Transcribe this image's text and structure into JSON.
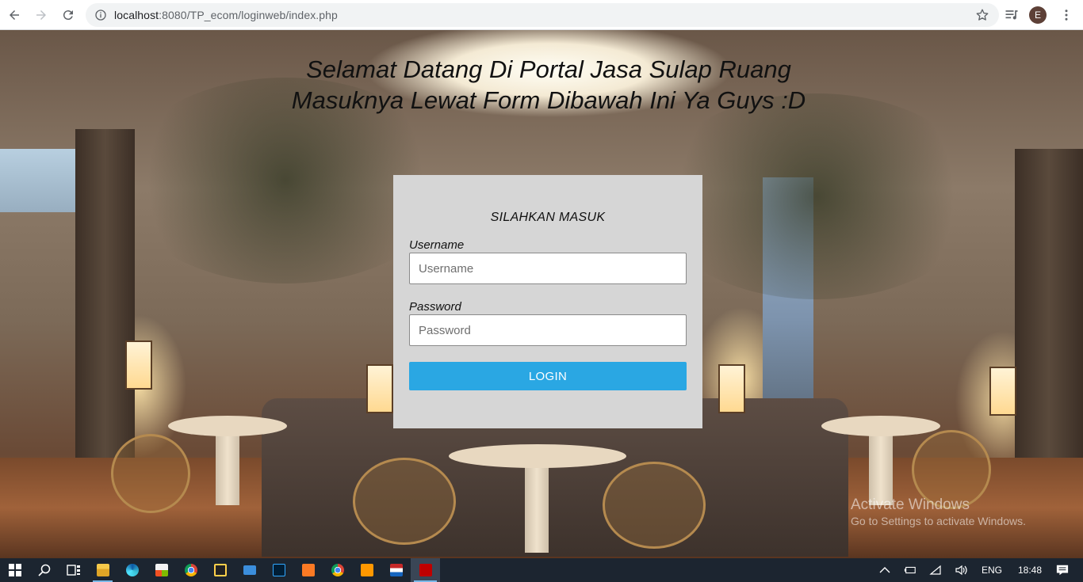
{
  "browser": {
    "url_host": "localhost",
    "url_path": ":8080/TP_ecom/loginweb/index.php",
    "profile_initial": "E",
    "icons": [
      "back-arrow-icon",
      "forward-arrow-icon",
      "reload-icon",
      "info-icon",
      "star-icon",
      "media-queue-icon",
      "kebab-menu-icon"
    ]
  },
  "page": {
    "title_line1": "Selamat Datang Di Portal Jasa Sulap Ruang",
    "title_line2": "Masuknya Lewat Form Dibawah Ini Ya Guys :D",
    "login": {
      "heading": "SILAHKAN MASUK",
      "username_label": "Username",
      "username_placeholder": "Username",
      "username_value": "",
      "password_label": "Password",
      "password_placeholder": "Password",
      "password_value": "",
      "button_label": "LOGIN"
    },
    "watermark": {
      "title": "Activate Windows",
      "subtitle": "Go to Settings to activate Windows."
    }
  },
  "taskbar": {
    "apps": [
      "start-icon",
      "search-icon",
      "task-view-icon",
      "file-explorer-icon",
      "edge-icon",
      "store-icon",
      "chrome-icon",
      "media-player-icon",
      "mail-icon",
      "photoshop-icon",
      "xampp-icon",
      "chrome-alt-icon",
      "sublime-icon",
      "flag-app-icon",
      "filezilla-icon"
    ],
    "language": "ENG",
    "time": "18:48"
  },
  "colors": {
    "card_bg": "#d6d6d6",
    "login_button": "#2aa7e3",
    "taskbar": "#1c2530"
  }
}
